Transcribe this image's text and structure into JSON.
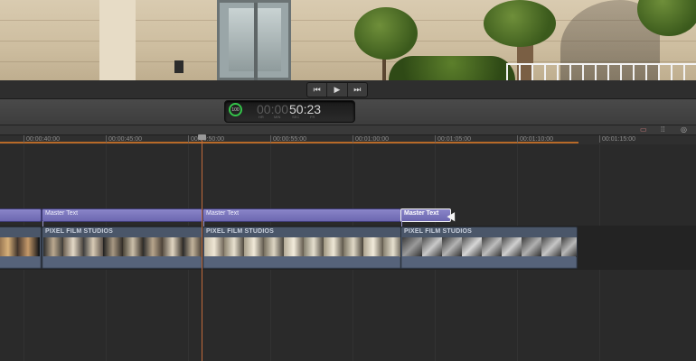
{
  "viewer": {
    "description_icon": "video-frame"
  },
  "transport": {
    "buttons": [
      {
        "name": "previous-edit-button",
        "glyph": "⏮"
      },
      {
        "name": "play-button",
        "glyph": "▶"
      },
      {
        "name": "next-edit-button",
        "glyph": "⏭"
      }
    ]
  },
  "timecode": {
    "percent": "100",
    "dim": "00:00",
    "value": "50:23",
    "units": [
      "HR",
      "MIN",
      "SEC",
      "FR"
    ]
  },
  "ruler": {
    "labels": [
      "00:00:40:00",
      "00:00:45:00",
      "00:00:50:00",
      "00:00:55:00",
      "00:01:00:00",
      "00:01:05:00",
      "00:01:10:00",
      "00:01:15:00"
    ]
  },
  "titles": [
    {
      "label": ""
    },
    {
      "label": "Master Text"
    },
    {
      "label": "Master Text"
    },
    {
      "label": "Master Text"
    }
  ],
  "clips": [
    {
      "label": ""
    },
    {
      "label": "PIXEL FILM STUDIOS"
    },
    {
      "label": "PIXEL FILM STUDIOS"
    },
    {
      "label": "PIXEL FILM STUDIOS"
    }
  ],
  "colors": {
    "title_clip": "#7a76bf",
    "video_clip": "#4a5669",
    "playhead": "#c06a3a",
    "ruler_range": "#b86a28",
    "timecode_ring": "#34c34a"
  }
}
